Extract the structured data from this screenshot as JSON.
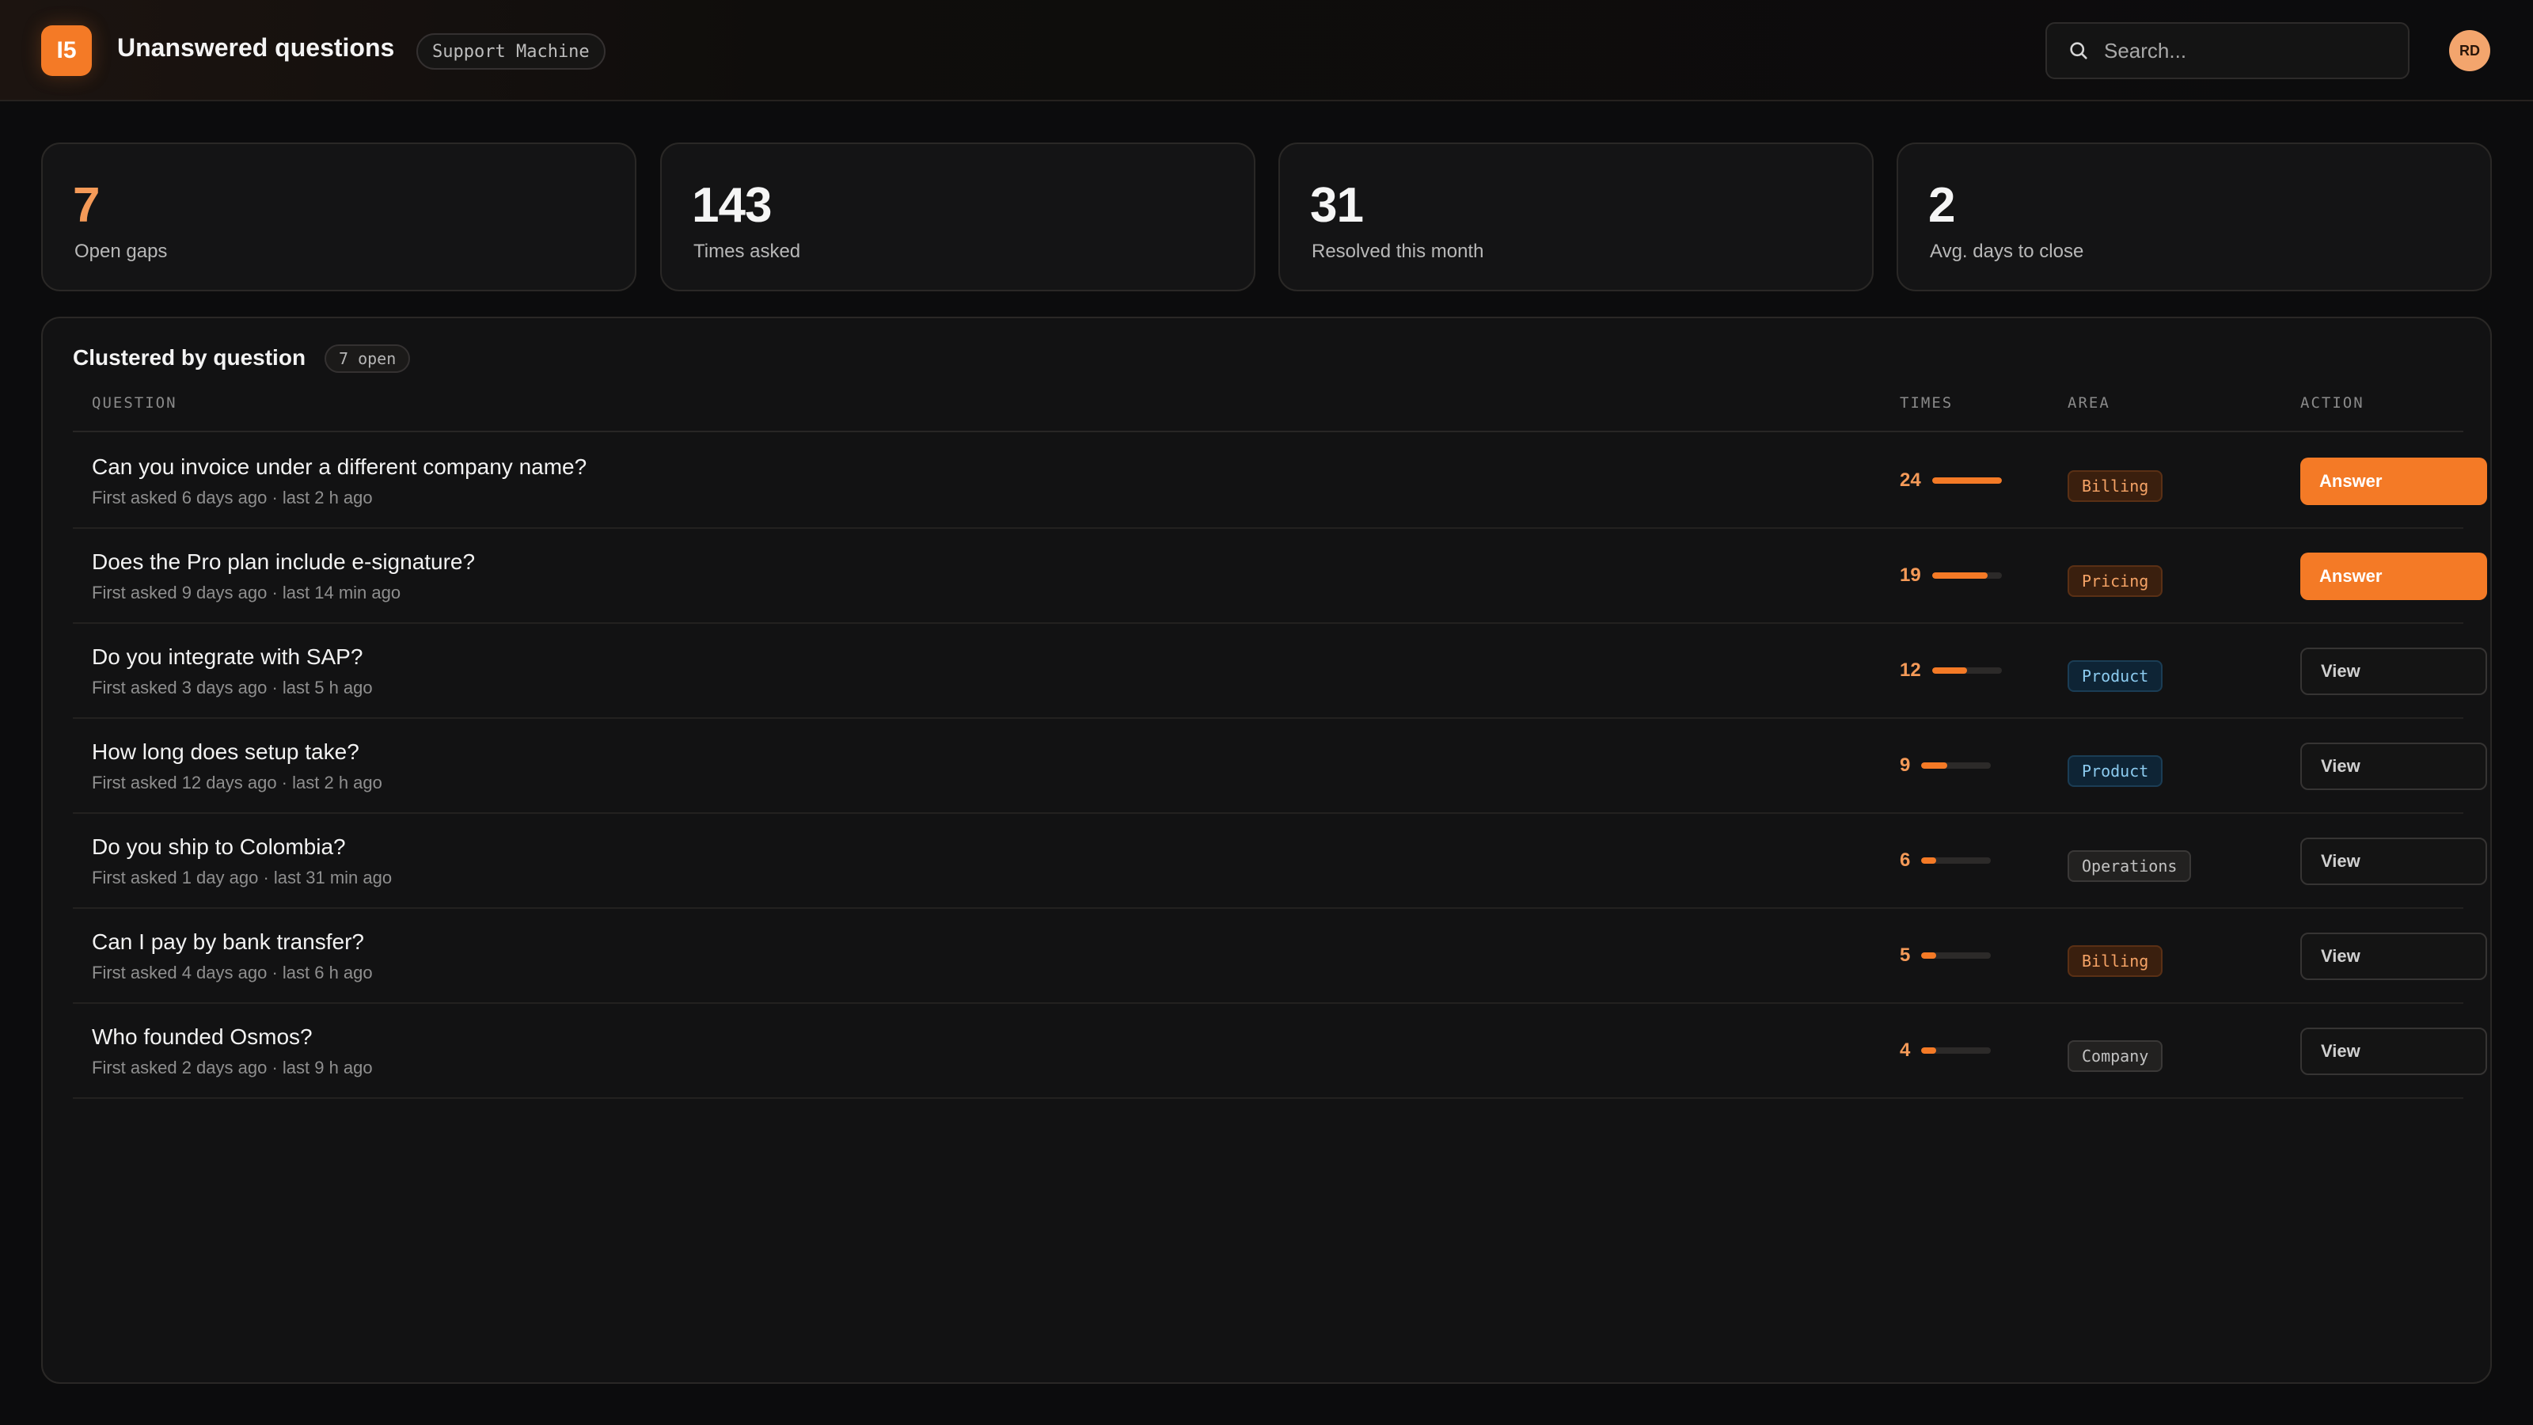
{
  "header": {
    "logo_text": "I5",
    "title": "Unanswered questions",
    "badge": "Support Machine",
    "search_placeholder": "Search...",
    "avatar_initials": "RD"
  },
  "stats": [
    {
      "value": "7",
      "label": "Open gaps",
      "accent": true
    },
    {
      "value": "143",
      "label": "Times asked",
      "accent": false
    },
    {
      "value": "31",
      "label": "Resolved this month",
      "accent": false
    },
    {
      "value": "2",
      "label": "Avg. days to close",
      "accent": false
    }
  ],
  "panel": {
    "title": "Clustered by question",
    "badge": "7 open",
    "columns": {
      "question": "QUESTION",
      "times": "TIMES",
      "area": "AREA",
      "action": "ACTION"
    }
  },
  "rows": [
    {
      "question": "Can you invoice under a different company name?",
      "meta": "First asked 6 days ago · last 2 h ago",
      "times": 24,
      "area": "Billing",
      "action": "Answer"
    },
    {
      "question": "Does the Pro plan include e-signature?",
      "meta": "First asked 9 days ago · last 14 min ago",
      "times": 19,
      "area": "Pricing",
      "action": "Answer"
    },
    {
      "question": "Do you integrate with SAP?",
      "meta": "First asked 3 days ago · last 5 h ago",
      "times": 12,
      "area": "Product",
      "action": "View"
    },
    {
      "question": "How long does setup take?",
      "meta": "First asked 12 days ago · last 2 h ago",
      "times": 9,
      "area": "Product",
      "action": "View"
    },
    {
      "question": "Do you ship to Colombia?",
      "meta": "First asked 1 day ago · last 31 min ago",
      "times": 6,
      "area": "Operations",
      "action": "View"
    },
    {
      "question": "Can I pay by bank transfer?",
      "meta": "First asked 4 days ago · last 6 h ago",
      "times": 5,
      "area": "Billing",
      "action": "View"
    },
    {
      "question": "Who founded Osmos?",
      "meta": "First asked 2 days ago · last 9 h ago",
      "times": 4,
      "area": "Company",
      "action": "View"
    }
  ],
  "colors": {
    "accent": "#f47a26",
    "accent_text": "#f59a58",
    "background": "#0c0c0d"
  },
  "icons": {
    "search": "search-icon"
  }
}
